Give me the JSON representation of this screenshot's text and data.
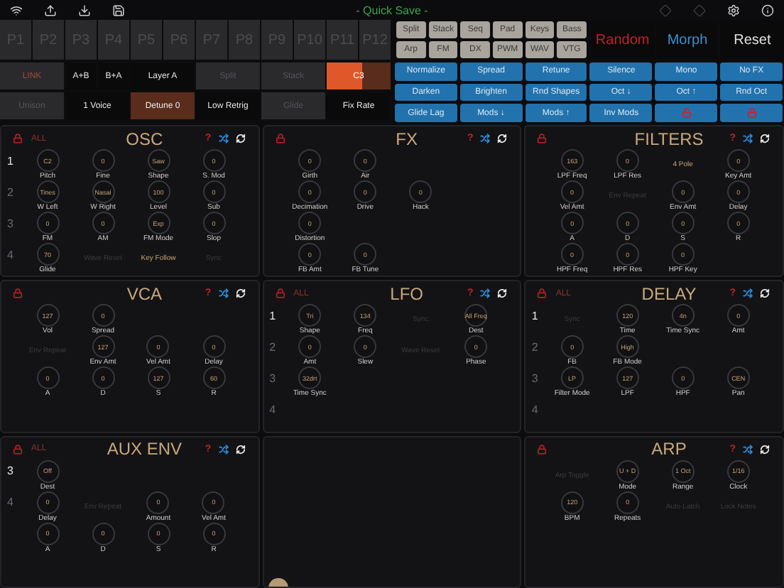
{
  "top_bar": {
    "title": "- Quick Save -"
  },
  "presets": [
    "P1",
    "P2",
    "P3",
    "P4",
    "P5",
    "P6",
    "P7",
    "P8",
    "P9",
    "P10",
    "P11",
    "P12"
  ],
  "layer_rows": [
    [
      {
        "kind": "link",
        "label": "LINK"
      },
      {
        "kind": "pair",
        "options": [
          "A+B",
          "B+A"
        ]
      },
      {
        "kind": "toggle",
        "label": "Layer A",
        "on": true
      },
      {
        "kind": "toggle",
        "label": "Split",
        "on": false
      },
      {
        "kind": "toggle",
        "label": "Stack",
        "on": false
      },
      {
        "kind": "slider",
        "label": "C3",
        "level": 0.55
      }
    ],
    [
      {
        "kind": "toggle",
        "label": "Unison",
        "on": false
      },
      {
        "kind": "toggle",
        "label": "1 Voice",
        "on": true
      },
      {
        "kind": "param",
        "label": "Detune 0"
      },
      {
        "kind": "toggle",
        "label": "Low Retrig",
        "on": true
      },
      {
        "kind": "toggle",
        "label": "Glide",
        "on": false
      },
      {
        "kind": "toggle",
        "label": "Fix Rate",
        "on": true
      }
    ]
  ],
  "categories": [
    "Split",
    "Stack",
    "Seq",
    "Pad",
    "Keys",
    "Bass",
    "Arp",
    "FM",
    "DX",
    "PWM",
    "WAV",
    "VTG"
  ],
  "actions": [
    {
      "label": "Random",
      "color": "#c0222a"
    },
    {
      "label": "Morph",
      "color": "#3a8fd0"
    },
    {
      "label": "Reset",
      "color": "#e0e0e0"
    }
  ],
  "tools": [
    {
      "kind": "text",
      "label": "Normalize"
    },
    {
      "kind": "text",
      "label": "Spread"
    },
    {
      "kind": "text",
      "label": "Retune"
    },
    {
      "kind": "text",
      "label": "Silence"
    },
    {
      "kind": "text",
      "label": "Mono"
    },
    {
      "kind": "text",
      "label": "No FX"
    },
    {
      "kind": "text",
      "label": "Darken"
    },
    {
      "kind": "text",
      "label": "Brighten"
    },
    {
      "kind": "text",
      "label": "Rnd Shapes"
    },
    {
      "kind": "text",
      "label": "Oct ↓"
    },
    {
      "kind": "text",
      "label": "Oct ↑"
    },
    {
      "kind": "text",
      "label": "Rnd Oct"
    },
    {
      "kind": "text",
      "label": "Glide Lag"
    },
    {
      "kind": "text",
      "label": "Mods ↓"
    },
    {
      "kind": "text",
      "label": "Mods ↑"
    },
    {
      "kind": "text",
      "label": "Inv Mods"
    },
    {
      "kind": "lock",
      "locked": false
    },
    {
      "kind": "lock",
      "locked": true
    }
  ],
  "panels": [
    {
      "kind": "module",
      "title": "OSC",
      "help": "?",
      "all_label": "ALL",
      "layers": [
        {
          "label": "1",
          "selected": true
        },
        {
          "label": "2",
          "selected": false
        },
        {
          "label": "3",
          "selected": false
        },
        {
          "label": "4",
          "selected": false
        }
      ],
      "rows": [
        [
          {
            "kind": "knob",
            "value": "C2",
            "label": "Pitch"
          },
          {
            "kind": "knob",
            "value": "0",
            "label": "Fine"
          },
          {
            "kind": "knob",
            "value": "Saw",
            "label": "Shape"
          },
          {
            "kind": "knob",
            "value": "0",
            "label": "S. Mod"
          }
        ],
        [
          {
            "kind": "knob",
            "value": "Tines",
            "label": "W Left"
          },
          {
            "kind": "knob",
            "value": "Nasal",
            "label": "W Right"
          },
          {
            "kind": "knob",
            "value": "100",
            "label": "Level"
          },
          {
            "kind": "knob",
            "value": "0",
            "label": "Sub"
          }
        ],
        [
          {
            "kind": "knob",
            "value": "0",
            "label": "FM"
          },
          {
            "kind": "knob",
            "value": "0",
            "label": "AM"
          },
          {
            "kind": "knob",
            "value": "Exp",
            "label": "FM Mode"
          },
          {
            "kind": "knob",
            "value": "0",
            "label": "Slop"
          }
        ],
        [
          {
            "kind": "knob",
            "value": "70",
            "label": "Glide"
          },
          {
            "kind": "toggle",
            "label": "Wave Reset",
            "on": false
          },
          {
            "kind": "toggle",
            "label": "Key Follow",
            "on": true
          },
          {
            "kind": "toggle",
            "label": "Sync",
            "on": false
          }
        ]
      ]
    },
    {
      "kind": "module",
      "title": "FX",
      "help": "?",
      "rows": [
        [
          {
            "kind": "knob",
            "value": "0",
            "label": "Girth"
          },
          {
            "kind": "knob",
            "value": "0",
            "label": "Air"
          }
        ],
        [
          {
            "kind": "knob",
            "value": "0",
            "label": "Decimation"
          },
          {
            "kind": "knob",
            "value": "0",
            "label": "Drive"
          },
          {
            "kind": "knob",
            "value": "0",
            "label": "Hack"
          }
        ],
        [
          {
            "kind": "knob",
            "value": "0",
            "label": "Distortion"
          }
        ],
        [
          {
            "kind": "knob",
            "value": "0",
            "label": "FB Amt"
          },
          {
            "kind": "knob",
            "value": "0",
            "label": "FB Tune"
          }
        ]
      ]
    },
    {
      "kind": "module",
      "title": "FILTERS",
      "help": "?",
      "rows": [
        [
          {
            "kind": "knob",
            "value": "163",
            "label": "LPF Freq"
          },
          {
            "kind": "knob",
            "value": "0",
            "label": "LPF Res"
          },
          {
            "kind": "toggle",
            "label": "4 Pole",
            "on": true
          },
          {
            "kind": "knob",
            "value": "0",
            "label": "Key Amt"
          }
        ],
        [
          {
            "kind": "knob",
            "value": "0",
            "label": "Vel Amt"
          },
          {
            "kind": "toggle",
            "label": "Env Repeat",
            "on": false
          },
          {
            "kind": "knob",
            "value": "0",
            "label": "Env Amt"
          },
          {
            "kind": "knob",
            "value": "0",
            "label": "Delay"
          }
        ],
        [
          {
            "kind": "knob",
            "value": "0",
            "label": "A"
          },
          {
            "kind": "knob",
            "value": "0",
            "label": "D"
          },
          {
            "kind": "knob",
            "value": "0",
            "label": "S"
          },
          {
            "kind": "knob",
            "value": "0",
            "label": "R"
          }
        ],
        [
          {
            "kind": "knob",
            "value": "0",
            "label": "HPF Freq"
          },
          {
            "kind": "knob",
            "value": "0",
            "label": "HPF Res"
          },
          {
            "kind": "knob",
            "value": "0",
            "label": "HPF Key"
          }
        ]
      ]
    },
    {
      "kind": "module",
      "title": "VCA",
      "help": "?",
      "rows": [
        [
          {
            "kind": "knob",
            "value": "127",
            "label": "Vol"
          },
          {
            "kind": "knob",
            "value": "0",
            "label": "Spread"
          }
        ],
        [
          {
            "kind": "toggle",
            "label": "Env Repeat",
            "on": false
          },
          {
            "kind": "knob",
            "value": "127",
            "label": "Env Amt"
          },
          {
            "kind": "knob",
            "value": "0",
            "label": "Vel Amt"
          },
          {
            "kind": "knob",
            "value": "0",
            "label": "Delay"
          }
        ],
        [
          {
            "kind": "knob",
            "value": "0",
            "label": "A"
          },
          {
            "kind": "knob",
            "value": "0",
            "label": "D"
          },
          {
            "kind": "knob",
            "value": "127",
            "label": "S"
          },
          {
            "kind": "knob",
            "value": "60",
            "label": "R"
          }
        ]
      ]
    },
    {
      "kind": "module",
      "title": "LFO",
      "help": "?",
      "all_label": "ALL",
      "layers": [
        {
          "label": "1",
          "selected": true
        },
        {
          "label": "2",
          "selected": false
        },
        {
          "label": "3",
          "selected": false
        },
        {
          "label": "4",
          "selected": false
        }
      ],
      "rows": [
        [
          {
            "kind": "knob",
            "value": "Tri",
            "label": "Shape"
          },
          {
            "kind": "knob",
            "value": "134",
            "label": "Freq"
          },
          {
            "kind": "toggle",
            "label": "Sync",
            "on": false
          },
          {
            "kind": "knob",
            "value": "All Freq",
            "label": "Dest"
          }
        ],
        [
          {
            "kind": "knob",
            "value": "0",
            "label": "Amt"
          },
          {
            "kind": "knob",
            "value": "0",
            "label": "Slew"
          },
          {
            "kind": "toggle",
            "label": "Wave Reset",
            "on": false
          },
          {
            "kind": "knob",
            "value": "0",
            "label": "Phase"
          }
        ],
        [
          {
            "kind": "knob",
            "value": "32drt",
            "label": "Time Sync"
          }
        ]
      ]
    },
    {
      "kind": "module",
      "title": "DELAY",
      "help": "?",
      "all_label": "ALL",
      "layers": [
        {
          "label": "1",
          "selected": true
        },
        {
          "label": "2",
          "selected": false
        },
        {
          "label": "3",
          "selected": false
        },
        {
          "label": "4",
          "selected": false
        }
      ],
      "rows": [
        [
          {
            "kind": "toggle",
            "label": "Sync",
            "on": false
          },
          {
            "kind": "knob",
            "value": "120",
            "label": "Time"
          },
          {
            "kind": "knob",
            "value": "4n",
            "label": "Time Sync"
          },
          {
            "kind": "knob",
            "value": "0",
            "label": "Amt"
          }
        ],
        [
          {
            "kind": "knob",
            "value": "0",
            "label": "FB"
          },
          {
            "kind": "knob",
            "value": "High",
            "label": "FB Mode"
          }
        ],
        [
          {
            "kind": "knob",
            "value": "LP",
            "label": "Filter Mode"
          },
          {
            "kind": "knob",
            "value": "127",
            "label": "LPF"
          },
          {
            "kind": "knob",
            "value": "0",
            "label": "HPF"
          },
          {
            "kind": "knob",
            "value": "CEN",
            "label": "Pan"
          }
        ]
      ]
    },
    {
      "kind": "module",
      "title": "AUX ENV",
      "help": "?",
      "all_label": "ALL",
      "layers": [
        {
          "label": "3",
          "selected": true
        },
        {
          "label": "4",
          "selected": false
        }
      ],
      "rows": [
        [
          {
            "kind": "knob",
            "value": "Off",
            "label": "Dest"
          }
        ],
        [
          {
            "kind": "knob",
            "value": "0",
            "label": "Delay"
          },
          {
            "kind": "toggle",
            "label": "Env Repeat",
            "on": false
          },
          {
            "kind": "knob",
            "value": "0",
            "label": "Amount"
          },
          {
            "kind": "knob",
            "value": "0",
            "label": "Vel Amt"
          }
        ],
        [
          {
            "kind": "knob",
            "value": "0",
            "label": "A"
          },
          {
            "kind": "knob",
            "value": "0",
            "label": "D"
          },
          {
            "kind": "knob",
            "value": "0",
            "label": "S"
          },
          {
            "kind": "knob",
            "value": "0",
            "label": "R"
          }
        ]
      ]
    },
    {
      "kind": "empty"
    },
    {
      "kind": "module",
      "title": "ARP",
      "help": "?",
      "rows": [
        [
          {
            "kind": "toggle",
            "label": "Arp Toggle",
            "on": false
          },
          {
            "kind": "knob",
            "value": "U + D",
            "label": "Mode"
          },
          {
            "kind": "knob",
            "value": "1 Oct",
            "label": "Range"
          },
          {
            "kind": "knob",
            "value": "1/16",
            "label": "Clock"
          }
        ],
        [
          {
            "kind": "knob",
            "value": "120",
            "label": "BPM"
          },
          {
            "kind": "knob",
            "value": "0",
            "label": "Repeats"
          },
          {
            "kind": "toggle",
            "label": "Auto Latch",
            "on": false
          },
          {
            "kind": "toggle",
            "label": "Lock Notes",
            "on": false
          }
        ]
      ]
    }
  ]
}
